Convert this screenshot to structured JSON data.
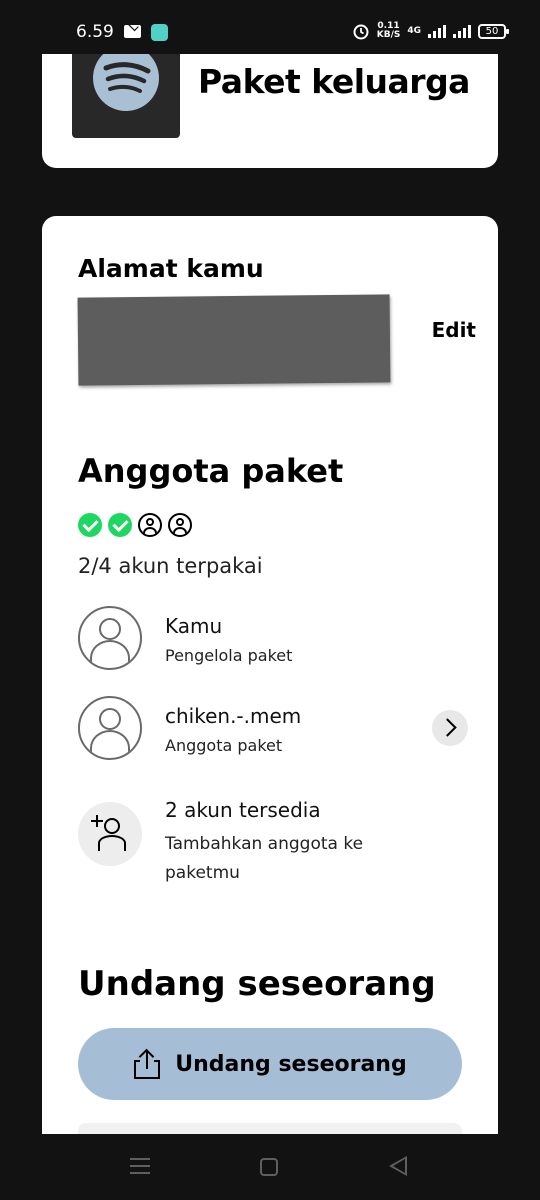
{
  "status_bar": {
    "time": "6.59",
    "net_speed_value": "0.11",
    "net_speed_unit": "KB/S",
    "network": "4G",
    "battery": "50",
    "icons": [
      "mail-icon",
      "chat-app-icon",
      "alarm-icon",
      "signal-icon",
      "battery-icon"
    ]
  },
  "plan": {
    "title": "Paket keluarga",
    "logo_icon": "spotify-logo-icon"
  },
  "address": {
    "heading": "Alamat kamu",
    "edit_label": "Edit"
  },
  "members": {
    "heading": "Anggota paket",
    "slots": [
      "filled",
      "filled",
      "empty",
      "empty"
    ],
    "usage_text": "2/4 akun terpakai",
    "list": [
      {
        "name": "Kamu",
        "role": "Pengelola paket"
      },
      {
        "name": "chiken.-.mem",
        "role": "Anggota paket"
      }
    ],
    "available_title": "2 akun tersedia",
    "available_desc": "Tambahkan anggota ke paketmu"
  },
  "invite": {
    "heading": "Undang seseorang",
    "button_label": "Undang seseorang",
    "button_color": "#a6bdd6"
  },
  "colors": {
    "background": "#121212",
    "card": "#ffffff",
    "accent_green": "#1ed760"
  }
}
